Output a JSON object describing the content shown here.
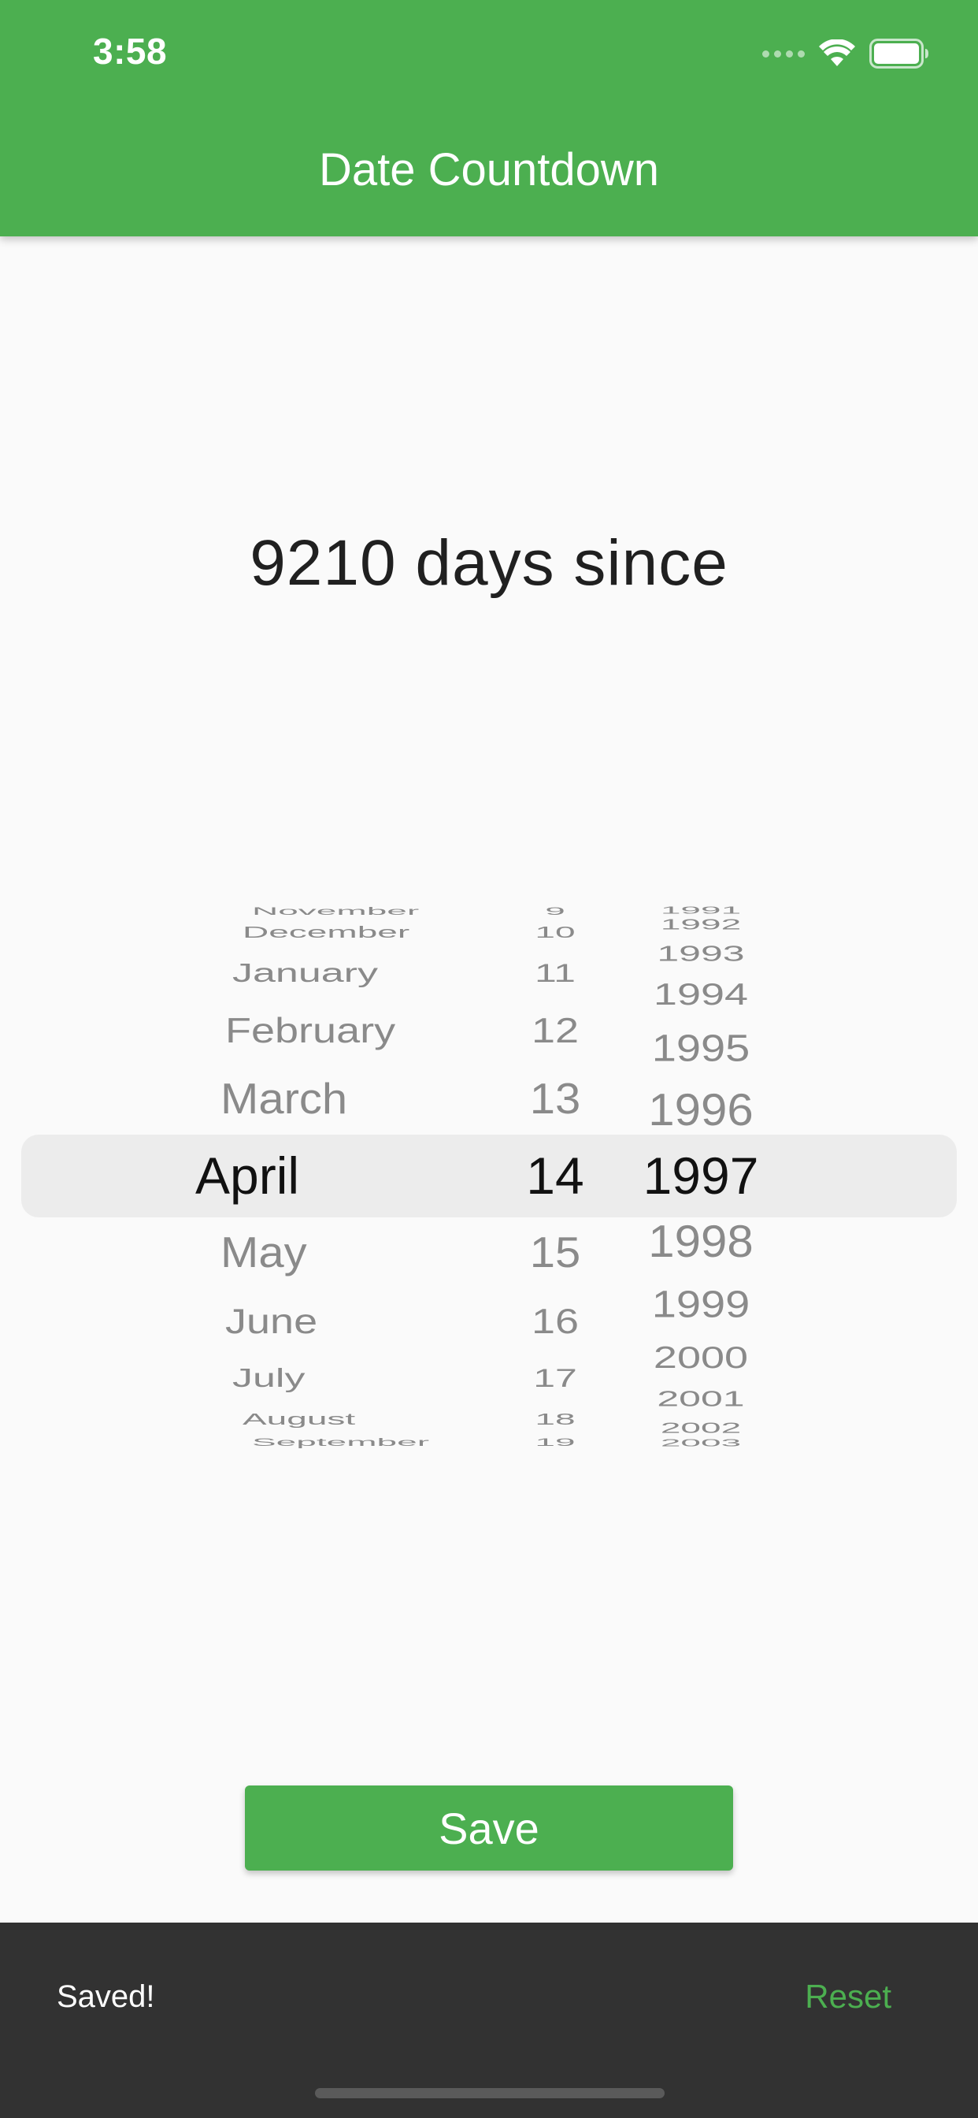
{
  "status_bar": {
    "time": "3:58",
    "icons": [
      "cellular-signal-icon",
      "wifi-icon",
      "battery-icon"
    ]
  },
  "app_bar": {
    "title": "Date Countdown",
    "color": "#4caf50"
  },
  "headline": "9210 days since",
  "date_picker": {
    "selected": {
      "month": "April",
      "day": "14",
      "year": "1997"
    },
    "months": [
      "November",
      "December",
      "January",
      "February",
      "March",
      "April",
      "May",
      "June",
      "July",
      "August",
      "September"
    ],
    "days": [
      "9",
      "10",
      "11",
      "12",
      "13",
      "14",
      "15",
      "16",
      "17",
      "18",
      "19"
    ],
    "years": [
      "1991",
      "1992",
      "1993",
      "1994",
      "1995",
      "1996",
      "1997",
      "1998",
      "1999",
      "2000",
      "2001",
      "2002",
      "2003"
    ]
  },
  "save_button": {
    "label": "Save"
  },
  "snackbar": {
    "message": "Saved!",
    "action": "Reset",
    "action_color": "#4caf50"
  }
}
